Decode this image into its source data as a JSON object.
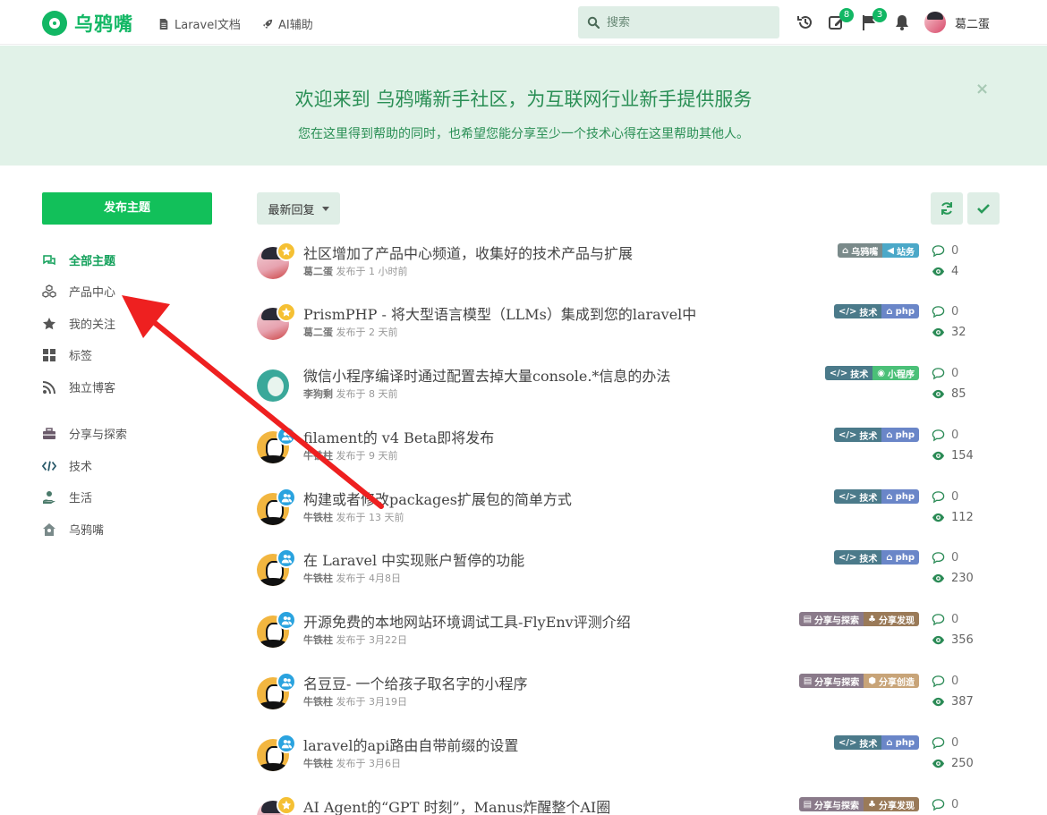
{
  "header": {
    "logo_text": "乌鸦嘴",
    "nav": [
      {
        "label": "Laravel文档",
        "icon": "document-icon"
      },
      {
        "label": "AI辅助",
        "icon": "rocket-icon"
      }
    ],
    "search_placeholder": "搜索",
    "icons": [
      {
        "name": "history-icon",
        "badge": ""
      },
      {
        "name": "edit-icon",
        "badge": "8"
      },
      {
        "name": "flag-icon",
        "badge": "3"
      },
      {
        "name": "bell-icon",
        "badge": ""
      }
    ],
    "username": "葛二蛋"
  },
  "banner": {
    "title": "欢迎来到 乌鸦嘴新手社区，为互联网行业新手提供服务",
    "subtitle": "您在这里得到帮助的同时，也希望您能分享至少一个技术心得在这里帮助其他人。",
    "close": "×"
  },
  "sidebar": {
    "publish_label": "发布主题",
    "items": [
      {
        "label": "全部主题",
        "icon": "comments-icon",
        "active": true
      },
      {
        "label": "产品中心",
        "icon": "cubes-icon"
      },
      {
        "label": "我的关注",
        "icon": "star-icon"
      },
      {
        "label": "标签",
        "icon": "grid-icon"
      },
      {
        "label": "独立博客",
        "icon": "rss-icon"
      },
      {
        "label": "分享与探索",
        "icon": "toolbox-icon"
      },
      {
        "label": "技术",
        "icon": "code-icon"
      },
      {
        "label": "生活",
        "icon": "hand-holding-icon"
      },
      {
        "label": "乌鸦嘴",
        "icon": "house-user-icon"
      }
    ]
  },
  "toolbar": {
    "sort_label": "最新回复"
  },
  "colors": {
    "accent": "#12c05a",
    "tag_tech": "#4b7a8a",
    "tag_php": "#6a86c8",
    "tag_share": "#8a7a8a",
    "tag_discover": "#9a7a58",
    "tag_create": "#c8a478",
    "tag_site": "#4ba8c8",
    "tag_crow": "#7a8a8a",
    "tag_mini": "#4bc078"
  },
  "topics": [
    {
      "title": "社区增加了产品中心频道，收集好的技术产品与扩展",
      "author": "葛二蛋",
      "time": "发布于 1 小时前",
      "avatar": "girl",
      "badge": "star",
      "tags": [
        {
          "label": "乌鸦嘴",
          "color": "#7a8a8a"
        },
        {
          "label": "站务",
          "color": "#4ba8c8"
        }
      ],
      "replies": "0",
      "views": "4"
    },
    {
      "title": "PrismPHP - 将大型语言模型（LLMs）集成到您的laravel中",
      "author": "葛二蛋",
      "time": "发布于 2 天前",
      "avatar": "girl",
      "badge": "star",
      "tags": [
        {
          "label": "技术",
          "color": "#4b7a8a"
        },
        {
          "label": "php",
          "color": "#6a86c8"
        }
      ],
      "replies": "0",
      "views": "32"
    },
    {
      "title": "微信小程序编译时通过配置去掉大量console.*信息的办法",
      "author": "李狗剩",
      "time": "发布于 8 天前",
      "avatar": "teal",
      "badge": "",
      "tags": [
        {
          "label": "技术",
          "color": "#4b7a8a"
        },
        {
          "label": "小程序",
          "color": "#4bc078"
        }
      ],
      "replies": "0",
      "views": "85"
    },
    {
      "title": "filament的 v4 Beta即将发布",
      "author": "牛铁柱",
      "time": "发布于 9 天前",
      "avatar": "man",
      "badge": "group",
      "tags": [
        {
          "label": "技术",
          "color": "#4b7a8a"
        },
        {
          "label": "php",
          "color": "#6a86c8"
        }
      ],
      "replies": "0",
      "views": "154"
    },
    {
      "title": "构建或者修改packages扩展包的简单方式",
      "author": "牛铁柱",
      "time": "发布于 13 天前",
      "avatar": "man",
      "badge": "group",
      "tags": [
        {
          "label": "技术",
          "color": "#4b7a8a"
        },
        {
          "label": "php",
          "color": "#6a86c8"
        }
      ],
      "replies": "0",
      "views": "112"
    },
    {
      "title": "在 Laravel 中实现账户暂停的功能",
      "author": "牛铁柱",
      "time": "发布于 4月8日",
      "avatar": "man",
      "badge": "group",
      "tags": [
        {
          "label": "技术",
          "color": "#4b7a8a"
        },
        {
          "label": "php",
          "color": "#6a86c8"
        }
      ],
      "replies": "0",
      "views": "230"
    },
    {
      "title": "开源免费的本地网站环境调试工具-FlyEnv评测介绍",
      "author": "牛铁柱",
      "time": "发布于 3月22日",
      "avatar": "man",
      "badge": "group",
      "tags": [
        {
          "label": "分享与探索",
          "color": "#8a7a8a"
        },
        {
          "label": "分享发现",
          "color": "#9a7a58"
        }
      ],
      "replies": "0",
      "views": "356"
    },
    {
      "title": "名豆豆- 一个给孩子取名字的小程序",
      "author": "牛铁柱",
      "time": "发布于 3月19日",
      "avatar": "man",
      "badge": "group",
      "tags": [
        {
          "label": "分享与探索",
          "color": "#8a7a8a"
        },
        {
          "label": "分享创造",
          "color": "#c8a478"
        }
      ],
      "replies": "0",
      "views": "387"
    },
    {
      "title": "laravel的api路由自带前缀的设置",
      "author": "牛铁柱",
      "time": "发布于 3月6日",
      "avatar": "man",
      "badge": "group",
      "tags": [
        {
          "label": "技术",
          "color": "#4b7a8a"
        },
        {
          "label": "php",
          "color": "#6a86c8"
        }
      ],
      "replies": "0",
      "views": "250"
    },
    {
      "title": "AI Agent的“GPT 时刻”，Manus炸醒整个AI圈",
      "author": "",
      "time": "",
      "avatar": "girl",
      "badge": "star",
      "tags": [
        {
          "label": "分享与探索",
          "color": "#8a7a8a"
        },
        {
          "label": "分享发现",
          "color": "#9a7a58"
        }
      ],
      "replies": "0",
      "views": ""
    }
  ]
}
